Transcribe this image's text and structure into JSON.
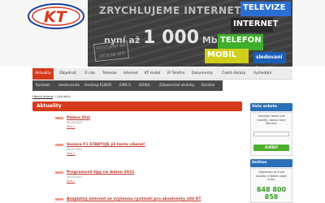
{
  "header": {
    "logo_text": "KT",
    "banner": {
      "slogan": "ZRYCHLUJEME INTERNET",
      "speed_prefix": "nyní až",
      "speed_value": "1 000",
      "speed_unit": "Mbit/s",
      "stamp": "DOSTUPNÝ NA OPTICKÉ SÍTI"
    },
    "tiles": {
      "tv": "TELEVIZE",
      "internet": "INTERNET",
      "telefon": "TELEFON",
      "mobil": "MOBIL",
      "tvlogo": "sledovaní tv"
    }
  },
  "nav_primary": [
    "Aktuality",
    "Objednat",
    "O nás",
    "Televize",
    "Internet",
    "KT mobil",
    "IP Telefon",
    "Dokumenty",
    "Časté dotazy",
    "Vyhledání"
  ],
  "nav_secondary": [
    "Kontakt",
    "eledovanitv",
    "Hosting ELBOX",
    "EMA.S",
    "SOIKA",
    "Zákaznické stránky",
    "Kariéra"
  ],
  "breadcrumb": {
    "home": "Hlavní strana",
    "sep": "»",
    "current": "Aktuality"
  },
  "main": {
    "heading": "Aktuality",
    "news": [
      {
        "title": "Pálava Stal",
        "date": "30.08.2021",
        "more": "Více »"
      },
      {
        "title": "Sezóna F1 STARTUJE již tento víkend!",
        "date": "19.03.2021",
        "more": "Více »"
      },
      {
        "title": "Programové tipy na duben 2021",
        "date": "19.03.2021",
        "more": "Více »"
      },
      {
        "title": "Bezplatný internet se zvýšenou rychlostí pro absolventy sítě KT",
        "date": "",
        "more": ""
      }
    ]
  },
  "sidebar": {
    "search_heading": "Vaše ankete",
    "search_text": "Zadejte název své lokality, dokud není stanoví:",
    "search_button": "OVĚŘIT",
    "hotline_heading": "Hotline",
    "hotline_text": "Objednat na Suvé stlažby můžete volat linky:",
    "hotline_number1": "848 800",
    "hotline_number2": "858"
  },
  "colors": {
    "accent": "#d63a1d",
    "sidebar_head": "#2d6fb7",
    "nav_dark": "#4a4a4a",
    "green": "#4caf2e"
  }
}
